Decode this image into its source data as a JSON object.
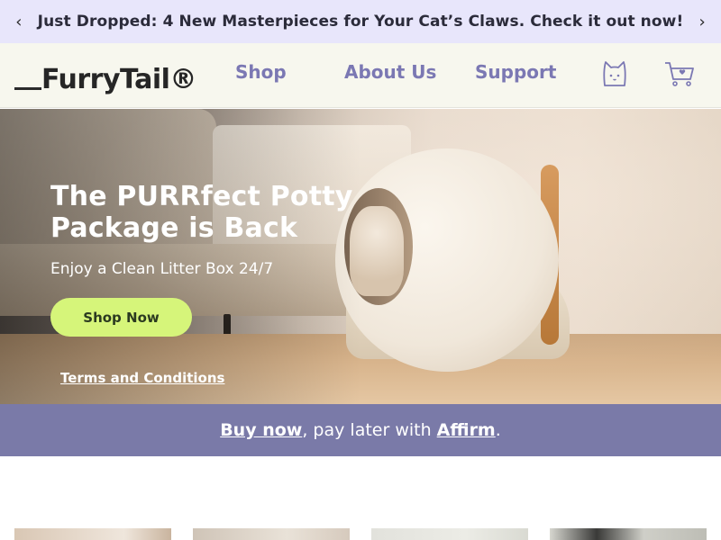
{
  "announcement": {
    "text": "Just Dropped: 4 New Masterpieces for Your Cat’s Claws. Check it out now!",
    "prev_glyph": "‹",
    "next_glyph": "›"
  },
  "header": {
    "logo_text": "FurryTail®",
    "nav": [
      {
        "label": "Shop"
      },
      {
        "label": "About Us"
      },
      {
        "label": "Support"
      }
    ],
    "icons": [
      "cat-account-icon",
      "cart-icon"
    ]
  },
  "hero": {
    "title": "The PURRfect Potty Package is Back",
    "subtitle": "Enjoy a Clean Litter Box 24/7",
    "button_label": "Shop Now",
    "terms_label": "Terms and Conditions"
  },
  "affirm": {
    "buy_now": "Buy now",
    "middle": ", pay later with ",
    "affirm": "Affirm",
    "end": "."
  },
  "colors": {
    "announcement_bg": "#e8e6fb",
    "header_bg": "#f7f7ee",
    "nav_text": "#7b78b3",
    "button_bg": "#d6f57a",
    "affirm_bg": "#7a7aa8"
  }
}
